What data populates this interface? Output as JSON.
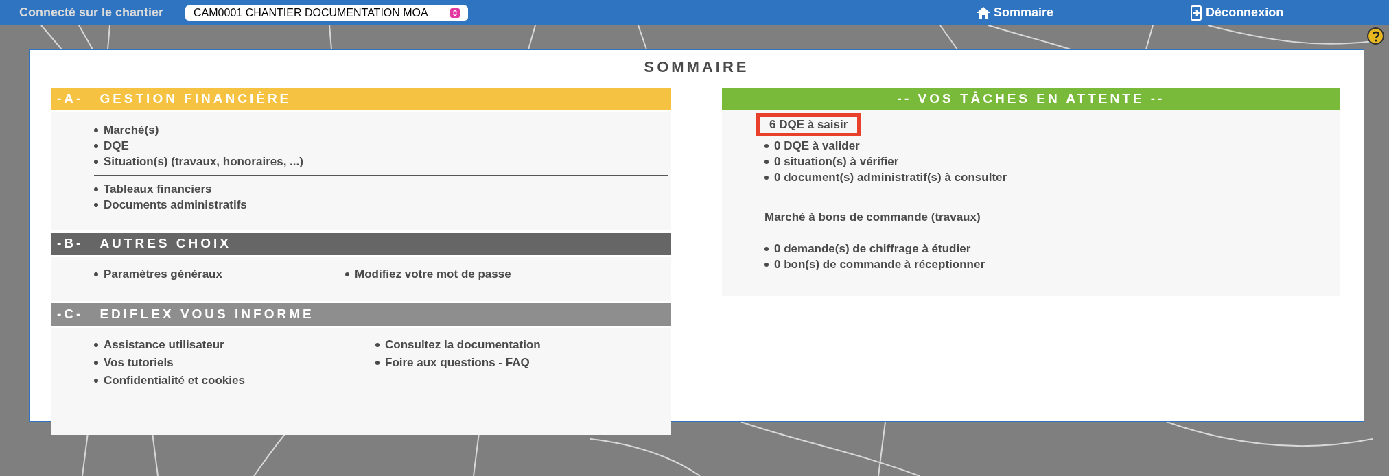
{
  "top_bar": {
    "site_label": "Connecté sur le chantier",
    "site_select": {
      "value": "CAM0001 CHANTIER DOCUMENTATION MOA"
    },
    "links": [
      {
        "label": "Sommaire",
        "kind": "home"
      },
      {
        "label": "Déconnexion",
        "kind": "logout"
      }
    ]
  },
  "title": "SOMMAIRE",
  "sections": [
    {
      "letter": "-A-",
      "title": "GESTION FINANCIÈRE",
      "color": "#f5c242",
      "kind": "groups",
      "blocks": [
        [
          "Marché(s)",
          "DQE",
          "Situation(s) (travaux, honoraires, ...)"
        ],
        [
          "Tableaux financiers",
          "Documents administratifs"
        ]
      ]
    },
    {
      "letter": "-B-",
      "title": "AUTRES CHOIX",
      "color": "#666666",
      "kind": "columns",
      "blocks": [
        [
          "Paramètres généraux"
        ],
        [
          "Modifiez votre mot de passe"
        ]
      ]
    },
    {
      "letter": "-C-",
      "title": "EDIFLEX VOUS INFORME",
      "color": "#8e8e8e",
      "kind": "columns",
      "blocks": [
        [
          "Assistance utilisateur",
          "Vos tutoriels",
          "Confidentialité et cookies"
        ],
        [
          "Consultez la documentation",
          "Foire aux questions - FAQ"
        ]
      ]
    }
  ],
  "tasks": {
    "title": "-- VOS TÂCHES EN ATTENTE --",
    "color": "#7aba3a",
    "items": [
      {
        "label": "6 DQE à saisir",
        "highlighted": true
      },
      {
        "label": "0 DQE à valider",
        "highlighted": false
      },
      {
        "label": "0 situation(s) à vérifier",
        "highlighted": false
      },
      {
        "label": "0 document(s) administratif(s) à consulter",
        "highlighted": false
      }
    ],
    "subheading": "Marché à bons de commande (travaux)",
    "sub_items": [
      "0 demande(s) de chiffrage à étudier",
      "0 bon(s) de commande à réceptionner"
    ]
  }
}
